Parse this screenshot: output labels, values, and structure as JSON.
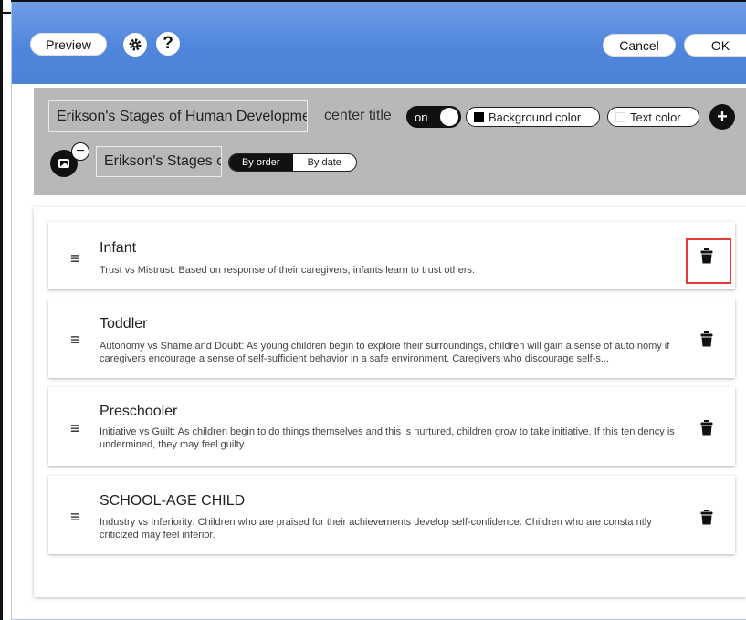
{
  "toolbar": {
    "preview_label": "Preview",
    "gear_icon": "gear-icon",
    "help_label": "?",
    "cancel_label": "Cancel",
    "ok_label": "OK",
    "background_color": "#4f86dc"
  },
  "header": {
    "title_value": "Erikson's Stages of Human Developme",
    "center_title_label": "center title",
    "toggle_label": "on",
    "background_color_label": "Background color",
    "text_color_label": "Text color",
    "add_label": "+",
    "remove_label": "−",
    "subtitle_value": "Erikson's Stages c",
    "order_options": [
      "By order",
      "By date"
    ],
    "selected_order": "By order"
  },
  "items": [
    {
      "title": "Infant",
      "description": "Trust vs Mistrust: Based on response of their caregivers, infants learn to trust others."
    },
    {
      "title": "Toddler",
      "description": "Autonomy vs Shame and Doubt: As young children begin to explore their surroundings, children will gain a sense of auto nomy if caregivers encourage a sense of self-sufficient behavior in a safe environment. Caregivers who discourage self-s..."
    },
    {
      "title": "Preschooler",
      "description": "Initiative vs Guilt: As children begin to do things themselves and this is nurtured, children grow to take initiative. If this ten dency is undermined, they may feel guilty."
    },
    {
      "title": "SCHOOL-AGE CHILD",
      "description": "Industry vs Inferiority: Children who are praised for their achievements develop self-confidence. Children who are consta ntly criticized may feel inferior."
    }
  ],
  "colors": {
    "highlight": "#e53935",
    "panel_gray": "#b8b8b8"
  }
}
